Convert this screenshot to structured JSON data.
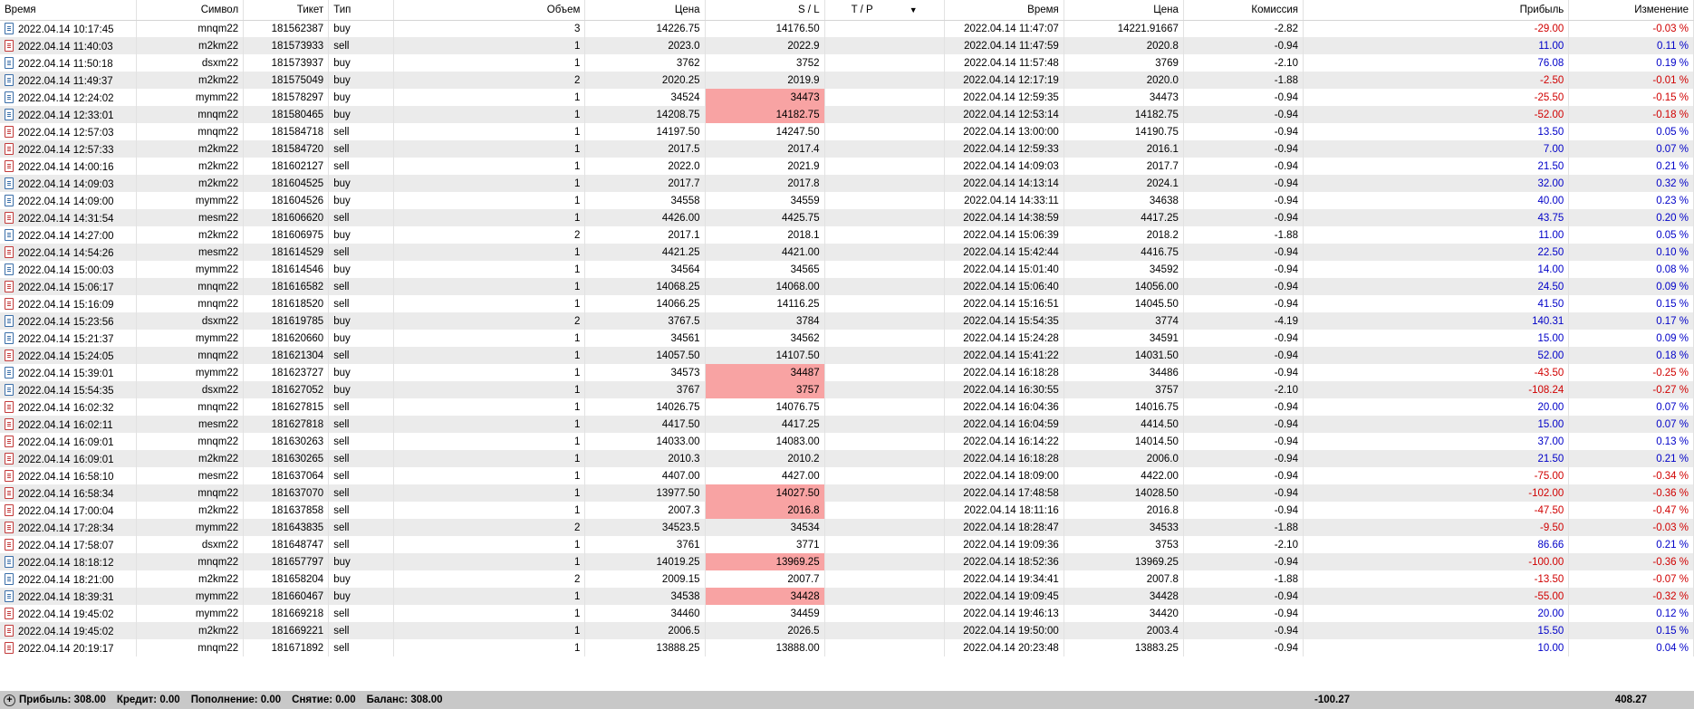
{
  "columns": [
    "Время",
    "Символ",
    "Тикет",
    "Тип",
    "Объем",
    "Цена",
    "S / L",
    "T / P",
    "Время",
    "Цена",
    "Комиссия",
    "Прибыль",
    "Изменение"
  ],
  "rows": [
    {
      "t1": "2022.04.14 10:17:45",
      "sym": "mnqm22",
      "ticket": "181562387",
      "type": "buy",
      "vol": "3",
      "price": "14226.75",
      "sl": "14176.50",
      "tp": "",
      "t2": "2022.04.14 11:47:07",
      "price2": "14221.91667",
      "comm": "-2.82",
      "profit": "-29.00",
      "change": "-0.03 %",
      "hl": false
    },
    {
      "t1": "2022.04.14 11:40:03",
      "sym": "m2km22",
      "ticket": "181573933",
      "type": "sell",
      "vol": "1",
      "price": "2023.0",
      "sl": "2022.9",
      "tp": "",
      "t2": "2022.04.14 11:47:59",
      "price2": "2020.8",
      "comm": "-0.94",
      "profit": "11.00",
      "change": "0.11 %",
      "hl": false
    },
    {
      "t1": "2022.04.14 11:50:18",
      "sym": "dsxm22",
      "ticket": "181573937",
      "type": "buy",
      "vol": "1",
      "price": "3762",
      "sl": "3752",
      "tp": "",
      "t2": "2022.04.14 11:57:48",
      "price2": "3769",
      "comm": "-2.10",
      "profit": "76.08",
      "change": "0.19 %",
      "hl": false
    },
    {
      "t1": "2022.04.14 11:49:37",
      "sym": "m2km22",
      "ticket": "181575049",
      "type": "buy",
      "vol": "2",
      "price": "2020.25",
      "sl": "2019.9",
      "tp": "",
      "t2": "2022.04.14 12:17:19",
      "price2": "2020.0",
      "comm": "-1.88",
      "profit": "-2.50",
      "change": "-0.01 %",
      "hl": false
    },
    {
      "t1": "2022.04.14 12:24:02",
      "sym": "mymm22",
      "ticket": "181578297",
      "type": "buy",
      "vol": "1",
      "price": "34524",
      "sl": "34473",
      "tp": "",
      "t2": "2022.04.14 12:59:35",
      "price2": "34473",
      "comm": "-0.94",
      "profit": "-25.50",
      "change": "-0.15 %",
      "hl": true
    },
    {
      "t1": "2022.04.14 12:33:01",
      "sym": "mnqm22",
      "ticket": "181580465",
      "type": "buy",
      "vol": "1",
      "price": "14208.75",
      "sl": "14182.75",
      "tp": "",
      "t2": "2022.04.14 12:53:14",
      "price2": "14182.75",
      "comm": "-0.94",
      "profit": "-52.00",
      "change": "-0.18 %",
      "hl": true
    },
    {
      "t1": "2022.04.14 12:57:03",
      "sym": "mnqm22",
      "ticket": "181584718",
      "type": "sell",
      "vol": "1",
      "price": "14197.50",
      "sl": "14247.50",
      "tp": "",
      "t2": "2022.04.14 13:00:00",
      "price2": "14190.75",
      "comm": "-0.94",
      "profit": "13.50",
      "change": "0.05 %",
      "hl": false
    },
    {
      "t1": "2022.04.14 12:57:33",
      "sym": "m2km22",
      "ticket": "181584720",
      "type": "sell",
      "vol": "1",
      "price": "2017.5",
      "sl": "2017.4",
      "tp": "",
      "t2": "2022.04.14 12:59:33",
      "price2": "2016.1",
      "comm": "-0.94",
      "profit": "7.00",
      "change": "0.07 %",
      "hl": false
    },
    {
      "t1": "2022.04.14 14:00:16",
      "sym": "m2km22",
      "ticket": "181602127",
      "type": "sell",
      "vol": "1",
      "price": "2022.0",
      "sl": "2021.9",
      "tp": "",
      "t2": "2022.04.14 14:09:03",
      "price2": "2017.7",
      "comm": "-0.94",
      "profit": "21.50",
      "change": "0.21 %",
      "hl": false
    },
    {
      "t1": "2022.04.14 14:09:03",
      "sym": "m2km22",
      "ticket": "181604525",
      "type": "buy",
      "vol": "1",
      "price": "2017.7",
      "sl": "2017.8",
      "tp": "",
      "t2": "2022.04.14 14:13:14",
      "price2": "2024.1",
      "comm": "-0.94",
      "profit": "32.00",
      "change": "0.32 %",
      "hl": false
    },
    {
      "t1": "2022.04.14 14:09:00",
      "sym": "mymm22",
      "ticket": "181604526",
      "type": "buy",
      "vol": "1",
      "price": "34558",
      "sl": "34559",
      "tp": "",
      "t2": "2022.04.14 14:33:11",
      "price2": "34638",
      "comm": "-0.94",
      "profit": "40.00",
      "change": "0.23 %",
      "hl": false
    },
    {
      "t1": "2022.04.14 14:31:54",
      "sym": "mesm22",
      "ticket": "181606620",
      "type": "sell",
      "vol": "1",
      "price": "4426.00",
      "sl": "4425.75",
      "tp": "",
      "t2": "2022.04.14 14:38:59",
      "price2": "4417.25",
      "comm": "-0.94",
      "profit": "43.75",
      "change": "0.20 %",
      "hl": false
    },
    {
      "t1": "2022.04.14 14:27:00",
      "sym": "m2km22",
      "ticket": "181606975",
      "type": "buy",
      "vol": "2",
      "price": "2017.1",
      "sl": "2018.1",
      "tp": "",
      "t2": "2022.04.14 15:06:39",
      "price2": "2018.2",
      "comm": "-1.88",
      "profit": "11.00",
      "change": "0.05 %",
      "hl": false
    },
    {
      "t1": "2022.04.14 14:54:26",
      "sym": "mesm22",
      "ticket": "181614529",
      "type": "sell",
      "vol": "1",
      "price": "4421.25",
      "sl": "4421.00",
      "tp": "",
      "t2": "2022.04.14 15:42:44",
      "price2": "4416.75",
      "comm": "-0.94",
      "profit": "22.50",
      "change": "0.10 %",
      "hl": false
    },
    {
      "t1": "2022.04.14 15:00:03",
      "sym": "mymm22",
      "ticket": "181614546",
      "type": "buy",
      "vol": "1",
      "price": "34564",
      "sl": "34565",
      "tp": "",
      "t2": "2022.04.14 15:01:40",
      "price2": "34592",
      "comm": "-0.94",
      "profit": "14.00",
      "change": "0.08 %",
      "hl": false
    },
    {
      "t1": "2022.04.14 15:06:17",
      "sym": "mnqm22",
      "ticket": "181616582",
      "type": "sell",
      "vol": "1",
      "price": "14068.25",
      "sl": "14068.00",
      "tp": "",
      "t2": "2022.04.14 15:06:40",
      "price2": "14056.00",
      "comm": "-0.94",
      "profit": "24.50",
      "change": "0.09 %",
      "hl": false
    },
    {
      "t1": "2022.04.14 15:16:09",
      "sym": "mnqm22",
      "ticket": "181618520",
      "type": "sell",
      "vol": "1",
      "price": "14066.25",
      "sl": "14116.25",
      "tp": "",
      "t2": "2022.04.14 15:16:51",
      "price2": "14045.50",
      "comm": "-0.94",
      "profit": "41.50",
      "change": "0.15 %",
      "hl": false
    },
    {
      "t1": "2022.04.14 15:23:56",
      "sym": "dsxm22",
      "ticket": "181619785",
      "type": "buy",
      "vol": "2",
      "price": "3767.5",
      "sl": "3784",
      "tp": "",
      "t2": "2022.04.14 15:54:35",
      "price2": "3774",
      "comm": "-4.19",
      "profit": "140.31",
      "change": "0.17 %",
      "hl": false
    },
    {
      "t1": "2022.04.14 15:21:37",
      "sym": "mymm22",
      "ticket": "181620660",
      "type": "buy",
      "vol": "1",
      "price": "34561",
      "sl": "34562",
      "tp": "",
      "t2": "2022.04.14 15:24:28",
      "price2": "34591",
      "comm": "-0.94",
      "profit": "15.00",
      "change": "0.09 %",
      "hl": false
    },
    {
      "t1": "2022.04.14 15:24:05",
      "sym": "mnqm22",
      "ticket": "181621304",
      "type": "sell",
      "vol": "1",
      "price": "14057.50",
      "sl": "14107.50",
      "tp": "",
      "t2": "2022.04.14 15:41:22",
      "price2": "14031.50",
      "comm": "-0.94",
      "profit": "52.00",
      "change": "0.18 %",
      "hl": false
    },
    {
      "t1": "2022.04.14 15:39:01",
      "sym": "mymm22",
      "ticket": "181623727",
      "type": "buy",
      "vol": "1",
      "price": "34573",
      "sl": "34487",
      "tp": "",
      "t2": "2022.04.14 16:18:28",
      "price2": "34486",
      "comm": "-0.94",
      "profit": "-43.50",
      "change": "-0.25 %",
      "hl": true
    },
    {
      "t1": "2022.04.14 15:54:35",
      "sym": "dsxm22",
      "ticket": "181627052",
      "type": "buy",
      "vol": "1",
      "price": "3767",
      "sl": "3757",
      "tp": "",
      "t2": "2022.04.14 16:30:55",
      "price2": "3757",
      "comm": "-2.10",
      "profit": "-108.24",
      "change": "-0.27 %",
      "hl": true
    },
    {
      "t1": "2022.04.14 16:02:32",
      "sym": "mnqm22",
      "ticket": "181627815",
      "type": "sell",
      "vol": "1",
      "price": "14026.75",
      "sl": "14076.75",
      "tp": "",
      "t2": "2022.04.14 16:04:36",
      "price2": "14016.75",
      "comm": "-0.94",
      "profit": "20.00",
      "change": "0.07 %",
      "hl": false
    },
    {
      "t1": "2022.04.14 16:02:11",
      "sym": "mesm22",
      "ticket": "181627818",
      "type": "sell",
      "vol": "1",
      "price": "4417.50",
      "sl": "4417.25",
      "tp": "",
      "t2": "2022.04.14 16:04:59",
      "price2": "4414.50",
      "comm": "-0.94",
      "profit": "15.00",
      "change": "0.07 %",
      "hl": false
    },
    {
      "t1": "2022.04.14 16:09:01",
      "sym": "mnqm22",
      "ticket": "181630263",
      "type": "sell",
      "vol": "1",
      "price": "14033.00",
      "sl": "14083.00",
      "tp": "",
      "t2": "2022.04.14 16:14:22",
      "price2": "14014.50",
      "comm": "-0.94",
      "profit": "37.00",
      "change": "0.13 %",
      "hl": false
    },
    {
      "t1": "2022.04.14 16:09:01",
      "sym": "m2km22",
      "ticket": "181630265",
      "type": "sell",
      "vol": "1",
      "price": "2010.3",
      "sl": "2010.2",
      "tp": "",
      "t2": "2022.04.14 16:18:28",
      "price2": "2006.0",
      "comm": "-0.94",
      "profit": "21.50",
      "change": "0.21 %",
      "hl": false
    },
    {
      "t1": "2022.04.14 16:58:10",
      "sym": "mesm22",
      "ticket": "181637064",
      "type": "sell",
      "vol": "1",
      "price": "4407.00",
      "sl": "4427.00",
      "tp": "",
      "t2": "2022.04.14 18:09:00",
      "price2": "4422.00",
      "comm": "-0.94",
      "profit": "-75.00",
      "change": "-0.34 %",
      "hl": false
    },
    {
      "t1": "2022.04.14 16:58:34",
      "sym": "mnqm22",
      "ticket": "181637070",
      "type": "sell",
      "vol": "1",
      "price": "13977.50",
      "sl": "14027.50",
      "tp": "",
      "t2": "2022.04.14 17:48:58",
      "price2": "14028.50",
      "comm": "-0.94",
      "profit": "-102.00",
      "change": "-0.36 %",
      "hl": true
    },
    {
      "t1": "2022.04.14 17:00:04",
      "sym": "m2km22",
      "ticket": "181637858",
      "type": "sell",
      "vol": "1",
      "price": "2007.3",
      "sl": "2016.8",
      "tp": "",
      "t2": "2022.04.14 18:11:16",
      "price2": "2016.8",
      "comm": "-0.94",
      "profit": "-47.50",
      "change": "-0.47 %",
      "hl": true
    },
    {
      "t1": "2022.04.14 17:28:34",
      "sym": "mymm22",
      "ticket": "181643835",
      "type": "sell",
      "vol": "2",
      "price": "34523.5",
      "sl": "34534",
      "tp": "",
      "t2": "2022.04.14 18:28:47",
      "price2": "34533",
      "comm": "-1.88",
      "profit": "-9.50",
      "change": "-0.03 %",
      "hl": false
    },
    {
      "t1": "2022.04.14 17:58:07",
      "sym": "dsxm22",
      "ticket": "181648747",
      "type": "sell",
      "vol": "1",
      "price": "3761",
      "sl": "3771",
      "tp": "",
      "t2": "2022.04.14 19:09:36",
      "price2": "3753",
      "comm": "-2.10",
      "profit": "86.66",
      "change": "0.21 %",
      "hl": false
    },
    {
      "t1": "2022.04.14 18:18:12",
      "sym": "mnqm22",
      "ticket": "181657797",
      "type": "buy",
      "vol": "1",
      "price": "14019.25",
      "sl": "13969.25",
      "tp": "",
      "t2": "2022.04.14 18:52:36",
      "price2": "13969.25",
      "comm": "-0.94",
      "profit": "-100.00",
      "change": "-0.36 %",
      "hl": true
    },
    {
      "t1": "2022.04.14 18:21:00",
      "sym": "m2km22",
      "ticket": "181658204",
      "type": "buy",
      "vol": "2",
      "price": "2009.15",
      "sl": "2007.7",
      "tp": "",
      "t2": "2022.04.14 19:34:41",
      "price2": "2007.8",
      "comm": "-1.88",
      "profit": "-13.50",
      "change": "-0.07 %",
      "hl": false
    },
    {
      "t1": "2022.04.14 18:39:31",
      "sym": "mymm22",
      "ticket": "181660467",
      "type": "buy",
      "vol": "1",
      "price": "34538",
      "sl": "34428",
      "tp": "",
      "t2": "2022.04.14 19:09:45",
      "price2": "34428",
      "comm": "-0.94",
      "profit": "-55.00",
      "change": "-0.32 %",
      "hl": true
    },
    {
      "t1": "2022.04.14 19:45:02",
      "sym": "mymm22",
      "ticket": "181669218",
      "type": "sell",
      "vol": "1",
      "price": "34460",
      "sl": "34459",
      "tp": "",
      "t2": "2022.04.14 19:46:13",
      "price2": "34420",
      "comm": "-0.94",
      "profit": "20.00",
      "change": "0.12 %",
      "hl": false
    },
    {
      "t1": "2022.04.14 19:45:02",
      "sym": "m2km22",
      "ticket": "181669221",
      "type": "sell",
      "vol": "1",
      "price": "2006.5",
      "sl": "2026.5",
      "tp": "",
      "t2": "2022.04.14 19:50:00",
      "price2": "2003.4",
      "comm": "-0.94",
      "profit": "15.50",
      "change": "0.15 %",
      "hl": false
    },
    {
      "t1": "2022.04.14 20:19:17",
      "sym": "mnqm22",
      "ticket": "181671892",
      "type": "sell",
      "vol": "1",
      "price": "13888.25",
      "sl": "13888.00",
      "tp": "",
      "t2": "2022.04.14 20:23:48",
      "price2": "13883.25",
      "comm": "-0.94",
      "profit": "10.00",
      "change": "0.04 %",
      "hl": false
    }
  ],
  "footer": {
    "profit": "Прибыль: 308.00",
    "credit": "Кредит: 0.00",
    "deposit": "Пополнение: 0.00",
    "withdrawal": "Снятие: 0.00",
    "balance": "Баланс: 308.00",
    "commission_total": "-100.27",
    "profit_total": "408.27"
  },
  "colors": {
    "highlight": "#f8a3a3",
    "negative": "#d00000",
    "positive": "#0000c8",
    "footer_bg": "#c8c8c8"
  },
  "icons": {
    "row": "document-icon",
    "footer": "plus-circle-icon",
    "sort": "sort-down-icon"
  }
}
